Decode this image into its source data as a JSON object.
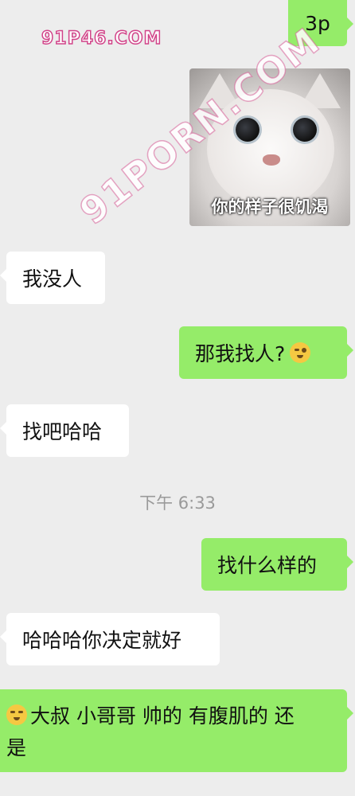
{
  "watermarks": {
    "top_left": "91P46.COM",
    "diagonal": "91PORN.COM"
  },
  "messages": [
    {
      "side": "out",
      "text": "3p"
    },
    {
      "side": "out",
      "type": "sticker",
      "caption": "你的样子很饥渴"
    },
    {
      "side": "in",
      "text": "我没人"
    },
    {
      "side": "out",
      "text": "那我找人?",
      "emoji": "wink-emoji"
    },
    {
      "side": "in",
      "text": "找吧哈哈"
    },
    {
      "side": "in",
      "text": "哈哈哈你决定就好"
    },
    {
      "side": "out",
      "text": "找什么样的"
    },
    {
      "side": "out",
      "emoji": "blush-emoji",
      "line1": "大叔 小哥哥 帅的 有腹肌的 还",
      "line2": "是"
    }
  ],
  "timestamp": "下午 6:33",
  "colors": {
    "background": "#ededed",
    "incoming": "#ffffff",
    "outgoing": "#95ec69"
  }
}
